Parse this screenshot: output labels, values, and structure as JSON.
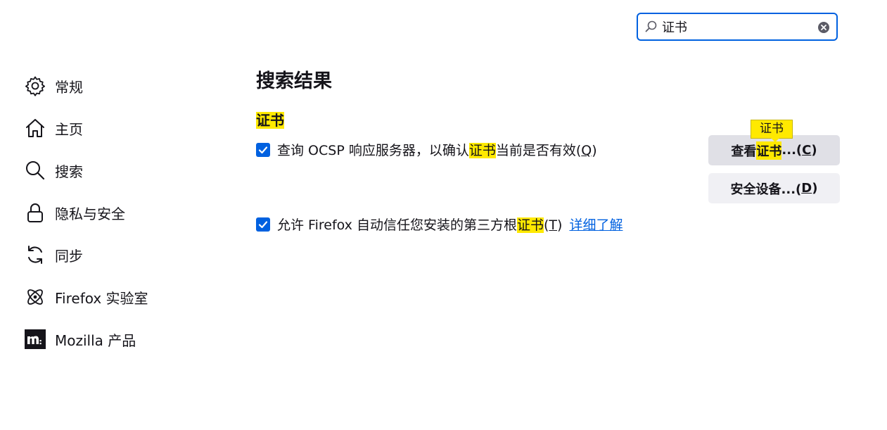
{
  "search": {
    "value": "证书",
    "icon": "search-icon",
    "clear_icon": "clear-icon"
  },
  "sidebar": {
    "items": [
      {
        "label": "常规",
        "icon": "gear-icon"
      },
      {
        "label": "主页",
        "icon": "home-icon"
      },
      {
        "label": "搜索",
        "icon": "search-icon"
      },
      {
        "label": "隐私与安全",
        "icon": "lock-icon"
      },
      {
        "label": "同步",
        "icon": "sync-icon"
      },
      {
        "label": "Firefox 实验室",
        "icon": "labs-atom-icon"
      },
      {
        "label": "Mozilla 产品",
        "icon": "mozilla-logo-icon"
      }
    ]
  },
  "main": {
    "title": "搜索结果",
    "section_heading": "证书",
    "ocsp": {
      "before": "查询 OCSP 响应服务器，以确认",
      "highlight": "证书",
      "after": "当前是否有效(",
      "accesskey": "Q",
      "close": ")",
      "checked": true
    },
    "trust": {
      "before": "允许 Firefox 自动信任您安装的第三方根",
      "highlight": "证书",
      "after_open": "(",
      "accesskey": "T",
      "close": ")",
      "checked": true,
      "link": "详细了解"
    },
    "view_button": {
      "before": "查看",
      "highlight": "证书",
      "after": "...(",
      "accesskey": "C",
      "close": ")"
    },
    "devices_button": {
      "before": "安全设备...(",
      "accesskey": "D",
      "close": ")"
    },
    "tooltip": "证书"
  },
  "colors": {
    "accent": "#0061e0",
    "highlight": "#ffe900",
    "text": "#15141a"
  }
}
